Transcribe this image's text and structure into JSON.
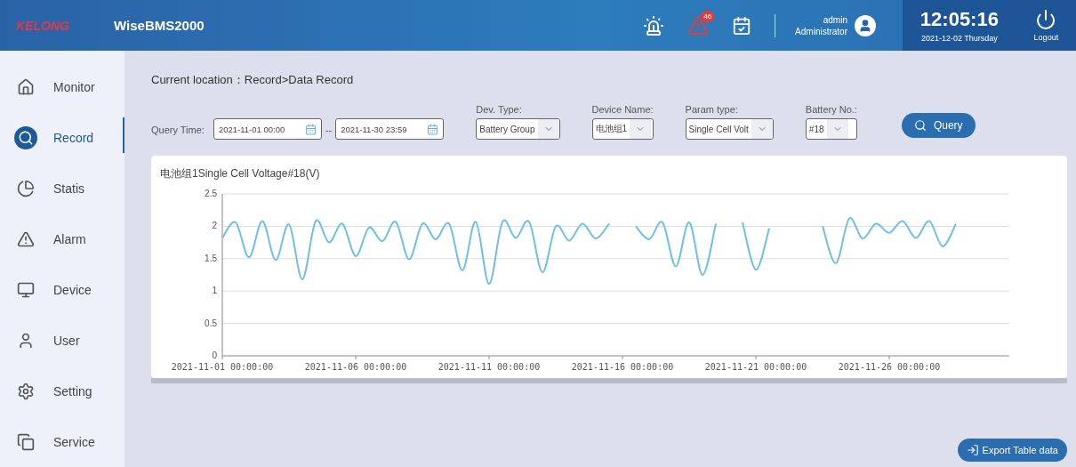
{
  "header": {
    "logo": "KELONG",
    "app_title": "WiseBMS2000",
    "alarm_badge": "46",
    "user_name": "admin",
    "user_role": "Administrator",
    "time": "12:05:16",
    "date": "2021-12-02 Thursday",
    "logout": "Logout"
  },
  "sidebar": {
    "items": [
      {
        "label": "Monitor",
        "selected": false
      },
      {
        "label": "Record",
        "selected": true
      },
      {
        "label": "Statis",
        "selected": false
      },
      {
        "label": "Alarm",
        "selected": false
      },
      {
        "label": "Device",
        "selected": false
      },
      {
        "label": "User",
        "selected": false
      },
      {
        "label": "Setting",
        "selected": false
      },
      {
        "label": "Service",
        "selected": false
      }
    ]
  },
  "breadcrumb": "Current location：Record>Data Record",
  "query": {
    "time_label": "Query Time:",
    "start": "2021-11-01 00:00",
    "separator": "--",
    "end": "2021-11-30 23:59",
    "selects": [
      {
        "label": "Dev. Type:",
        "value": "Battery Group"
      },
      {
        "label": "Device Name:",
        "value": "电池组1"
      },
      {
        "label": "Param type:",
        "value": "Single Cell Volt"
      },
      {
        "label": "Battery No.:",
        "value": "#18"
      }
    ],
    "button": "Query"
  },
  "chart": {
    "title": "电池组1Single Cell Voltage#18(V)",
    "chart_data": {
      "type": "line",
      "categories": [
        "2021-11-01 00:00:00",
        null,
        null,
        null,
        null,
        null,
        null,
        null,
        null,
        null,
        "2021-11-06 00:00:00",
        null,
        null,
        null,
        null,
        null,
        null,
        null,
        null,
        null,
        "2021-11-11 00:00:00",
        null,
        null,
        null,
        null,
        null,
        null,
        null,
        null,
        null,
        "2021-11-16 00:00:00",
        null,
        null,
        null,
        null,
        null,
        null,
        null,
        null,
        null,
        "2021-11-21 00:00:00",
        null,
        null,
        null,
        null,
        null,
        null,
        null,
        null,
        null,
        "2021-11-26 00:00:00",
        null,
        null,
        null,
        null,
        null,
        null,
        null,
        null,
        null
      ],
      "series": [
        {
          "color": "#6ec0e6",
          "values": [
            1.82,
            2.06,
            1.52,
            2.08,
            1.48,
            2.03,
            1.18,
            2.08,
            1.75,
            2.04,
            1.54,
            1.98,
            1.77,
            2.07,
            1.49,
            2.04,
            1.8,
            2.04,
            1.32,
            2.07,
            1.11,
            2.07,
            1.82,
            2.07,
            1.29,
            2.0,
            1.78,
            2.04,
            1.81,
            2.04,
            null,
            2.0,
            1.8,
            2.06,
            1.38,
            2.06,
            1.25,
            2.04,
            null,
            2.06,
            1.33,
            1.97,
            null,
            null,
            null,
            2.0,
            1.43,
            2.12,
            1.81,
            2.04,
            1.9,
            2.08,
            1.82,
            2.08,
            1.69,
            2.04,
            null,
            null,
            null,
            null
          ]
        }
      ],
      "ylim": [
        0,
        2.5
      ],
      "grid": true,
      "yticks": [
        0,
        {
          "value": 0.5,
          "label": "0.5"
        },
        {
          "value": 1,
          "label": "1"
        },
        {
          "value": 1.5,
          "label": "1.5"
        },
        {
          "value": 2,
          "label": "2"
        },
        {
          "value": 2.5,
          "label": "2.5"
        }
      ]
    }
  },
  "export_button": "Export Table data"
}
